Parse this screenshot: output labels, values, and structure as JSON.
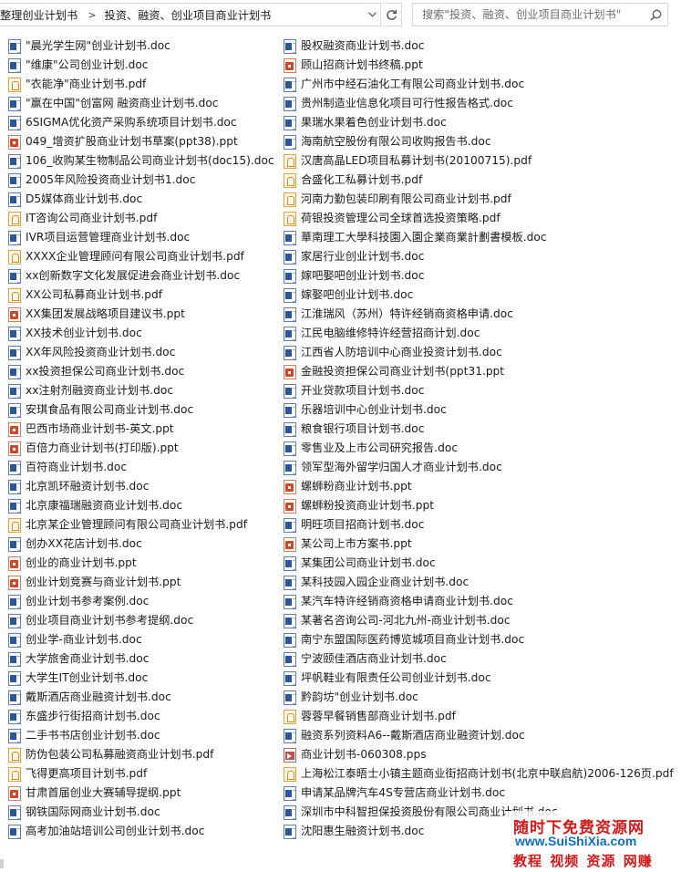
{
  "address_bar": {
    "breadcrumbs": [
      "整理创业计划书",
      "投资、融资、创业项目商业计划书"
    ],
    "separator_icon": "chevron-right-icon",
    "dropdown_icon": "chevron-down-icon",
    "refresh_icon": "refresh-icon"
  },
  "search": {
    "placeholder": "搜索\"投资、融资、创业项目商业计划书\"",
    "icon": "search-icon"
  },
  "files_left": [
    {
      "name": "\"晨光学生网\"创业计划书.doc",
      "type": "doc"
    },
    {
      "name": "\"维康\"公司创业计划.doc",
      "type": "doc"
    },
    {
      "name": "\"衣能净\"商业计划书.pdf",
      "type": "pdf"
    },
    {
      "name": "\"赢在中国\"创富网  融资商业计划书.doc",
      "type": "doc"
    },
    {
      "name": "6SIGMA优化资产采购系统项目计划书.doc",
      "type": "doc"
    },
    {
      "name": "049_增资扩股商业计划书草案(ppt38).ppt",
      "type": "ppt"
    },
    {
      "name": "106_收购某生物制品公司商业计划书(doc15).doc",
      "type": "doc"
    },
    {
      "name": "2005年风险投资商业计划书1.doc",
      "type": "doc"
    },
    {
      "name": "D5媒体商业计划书.doc",
      "type": "doc"
    },
    {
      "name": "IT咨询公司商业计划书.pdf",
      "type": "pdf"
    },
    {
      "name": "IVR项目运营管理商业计划书.doc",
      "type": "doc"
    },
    {
      "name": "XXXX企业管理顾问有限公司商业计划书.pdf",
      "type": "pdf"
    },
    {
      "name": "xx创新数字文化发展促进会商业计划书.doc",
      "type": "doc"
    },
    {
      "name": "XX公司私募商业计划书.pdf",
      "type": "pdf"
    },
    {
      "name": "XX集团发展战略项目建议书.ppt",
      "type": "ppt"
    },
    {
      "name": "XX技术创业计划书.doc",
      "type": "doc"
    },
    {
      "name": "XX年风险投资商业计划书.doc",
      "type": "doc"
    },
    {
      "name": "xx投资担保公司商业计划书.doc",
      "type": "doc"
    },
    {
      "name": "xx注射剂融资商业计划书.doc",
      "type": "doc"
    },
    {
      "name": "安琪食品有限公司商业计划书.doc",
      "type": "doc"
    },
    {
      "name": "巴西市场商业计划书-英文.ppt",
      "type": "ppt"
    },
    {
      "name": "百倍力商业计划书(打印版).ppt",
      "type": "ppt"
    },
    {
      "name": "百符商业计划书.doc",
      "type": "doc"
    },
    {
      "name": "北京凯环融资计划书.doc",
      "type": "doc"
    },
    {
      "name": "北京康福瑞融资商业计划书.doc",
      "type": "doc"
    },
    {
      "name": "北京某企业管理顾问有限公司商业计划书.pdf",
      "type": "pdf"
    },
    {
      "name": "创办XX花店计划书.doc",
      "type": "doc"
    },
    {
      "name": "创业的商业计划书.ppt",
      "type": "ppt"
    },
    {
      "name": "创业计划竞赛与商业计划书.ppt",
      "type": "ppt"
    },
    {
      "name": "创业计划书参考案例.doc",
      "type": "doc"
    },
    {
      "name": "创业项目商业计划书参考提纲.doc",
      "type": "doc"
    },
    {
      "name": "创业学-商业计划书.doc",
      "type": "doc"
    },
    {
      "name": "大学旅舍商业计划书.doc",
      "type": "doc"
    },
    {
      "name": "大学生IT创业计划书.doc",
      "type": "doc"
    },
    {
      "name": "戴斯酒店商业融资计划书.doc",
      "type": "doc"
    },
    {
      "name": "东盛步行街招商计划书.doc",
      "type": "doc"
    },
    {
      "name": "二手书书店创业计划书.doc",
      "type": "doc"
    },
    {
      "name": "防伪包装公司私募融资商业计划书.pdf",
      "type": "pdf"
    },
    {
      "name": "飞得更高项目计划书.pdf",
      "type": "pdf"
    },
    {
      "name": "甘肃首届创业大赛辅导提纲.ppt",
      "type": "ppt"
    },
    {
      "name": "钢铁国际网商业计划书.doc",
      "type": "doc"
    },
    {
      "name": "高考加油站培训公司创业计划书.doc",
      "type": "doc"
    }
  ],
  "files_right": [
    {
      "name": "股权融资商业计划书.doc",
      "type": "doc"
    },
    {
      "name": "顾山招商计划书终稿.ppt",
      "type": "ppt"
    },
    {
      "name": "广州市中经石油化工有限公司商业计划书.doc",
      "type": "doc"
    },
    {
      "name": "贵州制造业信息化项目可行性报告格式.doc",
      "type": "doc"
    },
    {
      "name": "果瑞水果着色创业计划书.doc",
      "type": "doc"
    },
    {
      "name": "海南航空股份有限公司收购报告书.doc",
      "type": "doc"
    },
    {
      "name": "汉唐高晶LED项目私募计划书(20100715).pdf",
      "type": "pdf"
    },
    {
      "name": "合盛化工私募计划书.pdf",
      "type": "pdf"
    },
    {
      "name": "河南力勤包装印刷有限公司商业计划书.pdf",
      "type": "pdf"
    },
    {
      "name": "荷银投资管理公司全球首选投资策略.pdf",
      "type": "pdf"
    },
    {
      "name": "華南理工大學科技園入園企業商業計劃書模板.doc",
      "type": "doc"
    },
    {
      "name": "家居行业创业计划书.doc",
      "type": "doc"
    },
    {
      "name": "嫁吧娶吧创业计划书.doc",
      "type": "doc"
    },
    {
      "name": "嫁娶吧创业计划书.doc",
      "type": "doc"
    },
    {
      "name": "江淮瑞风（苏州）特许经销商资格申请.doc",
      "type": "doc"
    },
    {
      "name": "江民电脑维修特许经营招商计划.doc",
      "type": "doc"
    },
    {
      "name": "江西省人防培训中心商业投资计划书.doc",
      "type": "doc"
    },
    {
      "name": "金融投资担保公司商业计划书(ppt31.ppt",
      "type": "ppt"
    },
    {
      "name": "开业贷款项目计划书.doc",
      "type": "doc"
    },
    {
      "name": "乐器培训中心创业计划书.doc",
      "type": "doc"
    },
    {
      "name": "粮食银行项目计划书.doc",
      "type": "doc"
    },
    {
      "name": "零售业及上市公司研究报告.doc",
      "type": "doc"
    },
    {
      "name": "领军型海外留学归国人才商业计划书.doc",
      "type": "doc"
    },
    {
      "name": "螺蛳粉商业计划书.ppt",
      "type": "ppt"
    },
    {
      "name": "螺蛳粉投资商业计划书.ppt",
      "type": "ppt"
    },
    {
      "name": "明旺项目招商计划书.doc",
      "type": "doc"
    },
    {
      "name": "某公司上市方案书.ppt",
      "type": "ppt"
    },
    {
      "name": "某集团公司商业计划书.doc",
      "type": "doc"
    },
    {
      "name": "某科技园入园企业商业计划书.doc",
      "type": "doc"
    },
    {
      "name": "某汽车特许经销商资格申请商业计划书.doc",
      "type": "doc"
    },
    {
      "name": "某著名咨询公司-河北九州-商业计划书.doc",
      "type": "doc"
    },
    {
      "name": "南宁东盟国际医药博览城项目商业计划书.doc",
      "type": "doc"
    },
    {
      "name": "宁波颐佳酒店商业计划书.doc",
      "type": "doc"
    },
    {
      "name": "坪帆鞋业有限责任公司创业计划书.doc",
      "type": "doc"
    },
    {
      "name": "黔韵坊\"创业计划书.doc",
      "type": "doc"
    },
    {
      "name": "蓉蓉早餐销售部商业计划书.pdf",
      "type": "pdf"
    },
    {
      "name": "融资系列资料A6--戴斯酒店商业融资计划.doc",
      "type": "doc"
    },
    {
      "name": "商业计划书-060308.pps",
      "type": "pps"
    },
    {
      "name": "上海松江泰晤士小镇主题商业街招商计划书(北京中联启航)2006-126页.pdf",
      "type": "pdf"
    },
    {
      "name": "申请某品牌汽车4S专营店商业计划书.doc",
      "type": "doc"
    },
    {
      "name": "深圳市中科智担保投资股份有限公司商业计划书.doc",
      "type": "doc"
    },
    {
      "name": "沈阳惠生融资计划书.doc",
      "type": "doc"
    }
  ],
  "watermark": {
    "line1": "随时下免费资源网",
    "line2": "www.SuiShiXia.com",
    "line3": [
      "教程",
      "视频",
      "资源",
      "网赚"
    ]
  }
}
